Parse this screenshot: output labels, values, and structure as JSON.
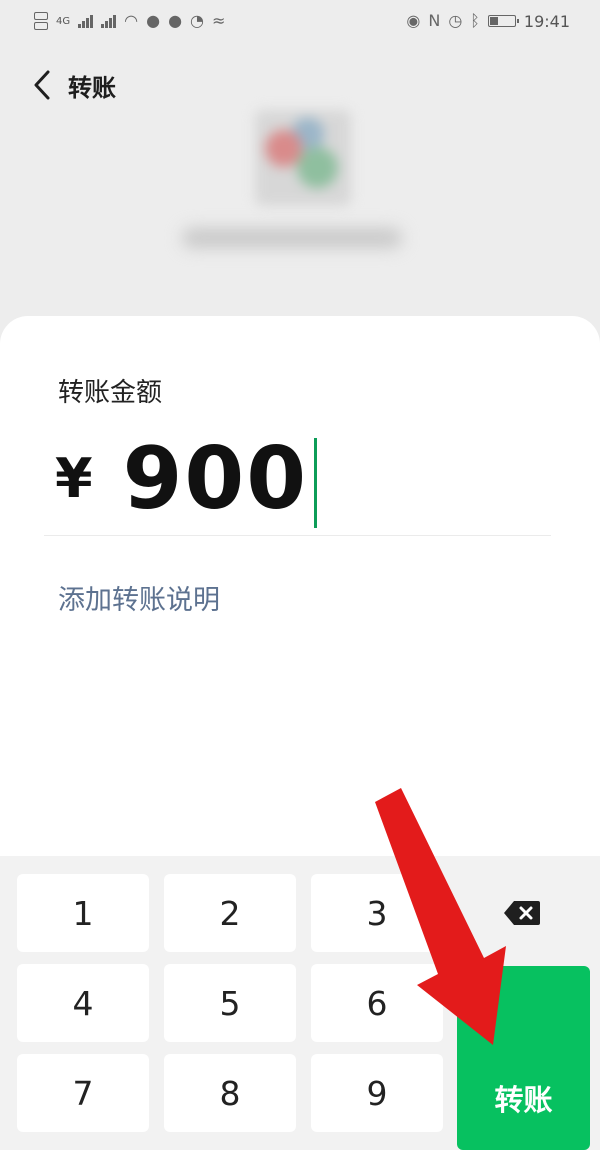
{
  "status_bar": {
    "left_text": "4G",
    "time": "19:41"
  },
  "header": {
    "title": "转账"
  },
  "form": {
    "amount_label": "转账金额",
    "currency": "¥",
    "amount": "900",
    "note_link": "添加转账说明"
  },
  "keypad": {
    "keys": [
      "1",
      "2",
      "3",
      "4",
      "5",
      "6",
      "7",
      "8",
      "9"
    ],
    "confirm": "转账"
  },
  "colors": {
    "accent": "#07c160",
    "link": "#5d7290",
    "annotation": "#e31b1b"
  }
}
